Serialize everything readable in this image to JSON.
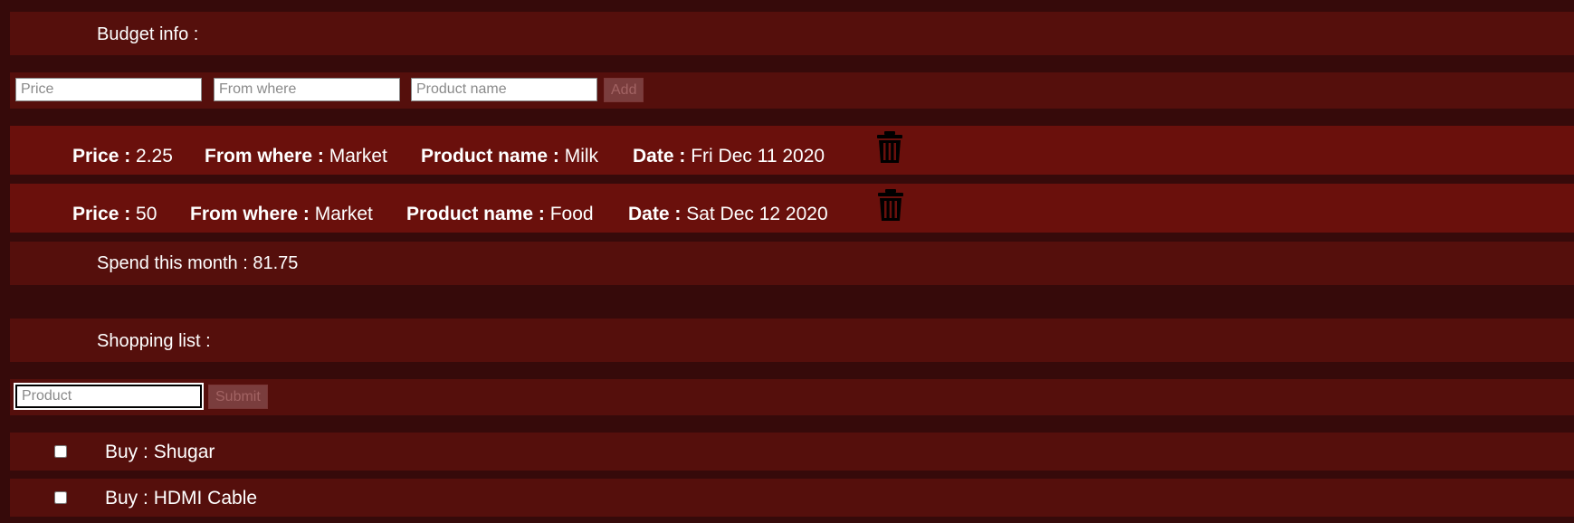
{
  "budget": {
    "title": "Budget info :",
    "form": {
      "price_placeholder": "Price",
      "from_placeholder": "From where",
      "product_placeholder": "Product name",
      "add_label": "Add"
    },
    "items": [
      {
        "price_label": "Price :",
        "price": "2.25",
        "from_label": "From where :",
        "from": "Market",
        "product_label": "Product name :",
        "product": "Milk",
        "date_label": "Date :",
        "date": "Fri Dec 11 2020",
        "delete_icon": "trash-icon"
      },
      {
        "price_label": "Price :",
        "price": "50",
        "from_label": "From where :",
        "from": "Market",
        "product_label": "Product name :",
        "product": "Food",
        "date_label": "Date :",
        "date": "Sat Dec 12 2020",
        "delete_icon": "trash-icon"
      }
    ],
    "spend_text": "Spend this month : 81.75"
  },
  "shopping": {
    "title": "Shopping list :",
    "form": {
      "product_placeholder": "Product",
      "submit_label": "Submit"
    },
    "items": [
      {
        "label": "Buy : Shugar",
        "checked": false
      },
      {
        "label": "Buy : HDMI Cable",
        "checked": false
      }
    ]
  },
  "colors": {
    "page_background": "#360a0a",
    "band": "#550f0c",
    "item_band": "#6a100c",
    "text": "#ffffff",
    "disabled_button": "#7a3d3d"
  }
}
